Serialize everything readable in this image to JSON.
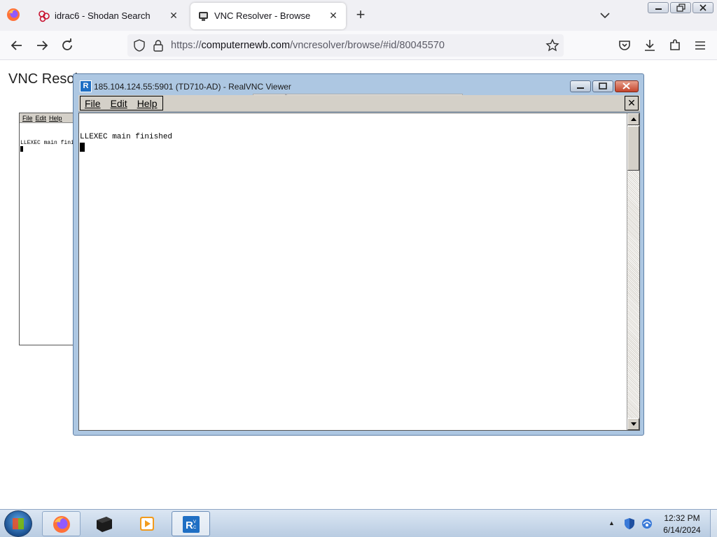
{
  "browser": {
    "tabs": [
      {
        "title": "idrac6 - Shodan Search",
        "icon": "shodan-icon",
        "active": false
      },
      {
        "title": "VNC Resolver - Browse",
        "icon": "vnc-resolver-icon",
        "active": true
      }
    ],
    "url": {
      "scheme": "https://",
      "host": "computernewb.com",
      "path": "/vncresolver/browse/#id/80045570"
    },
    "accent_color": "#0061e0"
  },
  "page": {
    "heading": "VNC Resolver",
    "thumbnail": {
      "menu": [
        "File",
        "Edit",
        "Help"
      ],
      "line": "LLEXEC main finished"
    }
  },
  "vnc_viewer": {
    "title": "185.104.124.55:5901 (TD710-AD) - RealVNC Viewer",
    "menu": [
      "File",
      "Edit",
      "Help"
    ],
    "close_glyph": "✕",
    "terminal_line": "LLEXEC main finished",
    "titlebar_color": "#adc7e2"
  },
  "taskbar": {
    "apps": [
      "firefox-icon",
      "terminal-app-icon",
      "media-player-icon",
      "realvnc-icon"
    ],
    "tray_arrow": "▲",
    "time": "12:32 PM",
    "date": "6/14/2024"
  }
}
